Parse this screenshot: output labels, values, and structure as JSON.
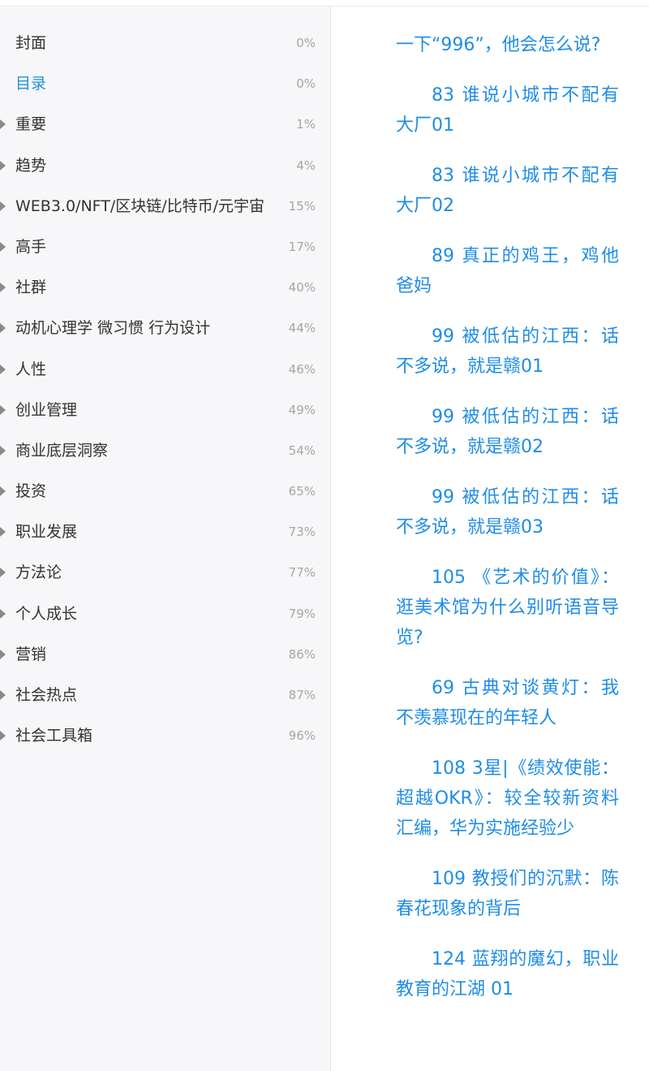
{
  "toc": {
    "items": [
      {
        "label": "封面",
        "percent": "0%",
        "has_children": false,
        "active": false
      },
      {
        "label": "目录",
        "percent": "0%",
        "has_children": false,
        "active": true
      },
      {
        "label": "重要",
        "percent": "1%",
        "has_children": true,
        "active": false
      },
      {
        "label": "趋势",
        "percent": "4%",
        "has_children": true,
        "active": false
      },
      {
        "label": "WEB3.0/NFT/区块链/比特币/元宇宙",
        "percent": "15%",
        "has_children": true,
        "active": false
      },
      {
        "label": "高手",
        "percent": "17%",
        "has_children": true,
        "active": false
      },
      {
        "label": "社群",
        "percent": "40%",
        "has_children": true,
        "active": false
      },
      {
        "label": "动机心理学 微习惯 行为设计",
        "percent": "44%",
        "has_children": true,
        "active": false
      },
      {
        "label": "人性",
        "percent": "46%",
        "has_children": true,
        "active": false
      },
      {
        "label": "创业管理",
        "percent": "49%",
        "has_children": true,
        "active": false
      },
      {
        "label": "商业底层洞察",
        "percent": "54%",
        "has_children": true,
        "active": false
      },
      {
        "label": "投资",
        "percent": "65%",
        "has_children": true,
        "active": false
      },
      {
        "label": "职业发展",
        "percent": "73%",
        "has_children": true,
        "active": false
      },
      {
        "label": "方法论",
        "percent": "77%",
        "has_children": true,
        "active": false
      },
      {
        "label": "个人成长",
        "percent": "79%",
        "has_children": true,
        "active": false
      },
      {
        "label": "营销",
        "percent": "86%",
        "has_children": true,
        "active": false
      },
      {
        "label": "社会热点",
        "percent": "87%",
        "has_children": true,
        "active": false
      },
      {
        "label": "社会工具箱",
        "percent": "96%",
        "has_children": true,
        "active": false
      }
    ]
  },
  "content": {
    "entries": [
      {
        "text": "一下“996”，他会怎么说?",
        "continuation": true
      },
      {
        "text": "83 谁说小城市不配有大厂01",
        "continuation": false
      },
      {
        "text": "83 谁说小城市不配有大厂02",
        "continuation": false
      },
      {
        "text": "89 真正的鸡王，鸡他爸妈",
        "continuation": false
      },
      {
        "text": "99 被低估的江西：话不多说，就是赣01",
        "continuation": false
      },
      {
        "text": "99 被低估的江西：话不多说，就是赣02",
        "continuation": false
      },
      {
        "text": "99 被低估的江西：话不多说，就是赣03",
        "continuation": false
      },
      {
        "text": "105 《艺术的价值》：逛美术馆为什么别听语音导览?",
        "continuation": false
      },
      {
        "text": "69 古典对谈黄灯：我不羡慕现在的年轻人",
        "continuation": false
      },
      {
        "text": "108 3星|《绩效使能：超越OKR》：较全较新资料汇编，华为实施经验少",
        "continuation": false
      },
      {
        "text": "109 教授们的沉默：陈春花现象的背后",
        "continuation": false
      },
      {
        "text": "124 蓝翔的魔幻，职业教育的江湖 01",
        "continuation": false
      }
    ]
  },
  "colors": {
    "link": "#1f8ce6",
    "active": "#1e90e0",
    "sidebar_bg": "#f7f7f9",
    "percent": "#a5a5a5"
  }
}
